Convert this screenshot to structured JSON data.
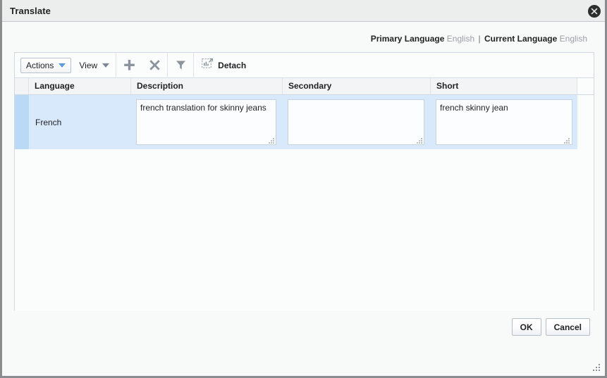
{
  "window": {
    "title": "Translate",
    "close_icon": "close-circle-icon"
  },
  "header": {
    "primary_language_label": "Primary Language",
    "primary_language_value": "English",
    "separator": "|",
    "current_language_label": "Current Language",
    "current_language_value": "English"
  },
  "toolbar": {
    "actions_label": "Actions",
    "view_label": "View",
    "add_icon": "plus-icon",
    "delete_icon": "cross-icon",
    "filter_icon": "funnel-icon",
    "detach_icon": "detach-icon",
    "detach_label": "Detach"
  },
  "table": {
    "columns": [
      {
        "key": "language",
        "label": "Language"
      },
      {
        "key": "description",
        "label": "Description"
      },
      {
        "key": "secondary",
        "label": "Secondary"
      },
      {
        "key": "short",
        "label": "Short"
      }
    ],
    "rows": [
      {
        "selected": true,
        "language": "French",
        "description": "french translation for skinny jeans",
        "secondary": "",
        "short": "french skinny jean"
      }
    ]
  },
  "footer": {
    "ok_label": "OK",
    "cancel_label": "Cancel"
  },
  "colors": {
    "titlebar_bg": "#eceded",
    "body_bg": "#f8f9f9",
    "panel_border": "#cfd9e3",
    "header_bg": "#f2f4f6",
    "row_selected_bg": "#d7e9fb",
    "row_selector_bg": "#b9d9f5",
    "accent_blue": "#5b9bd5",
    "muted_text": "#9aa0a6"
  }
}
